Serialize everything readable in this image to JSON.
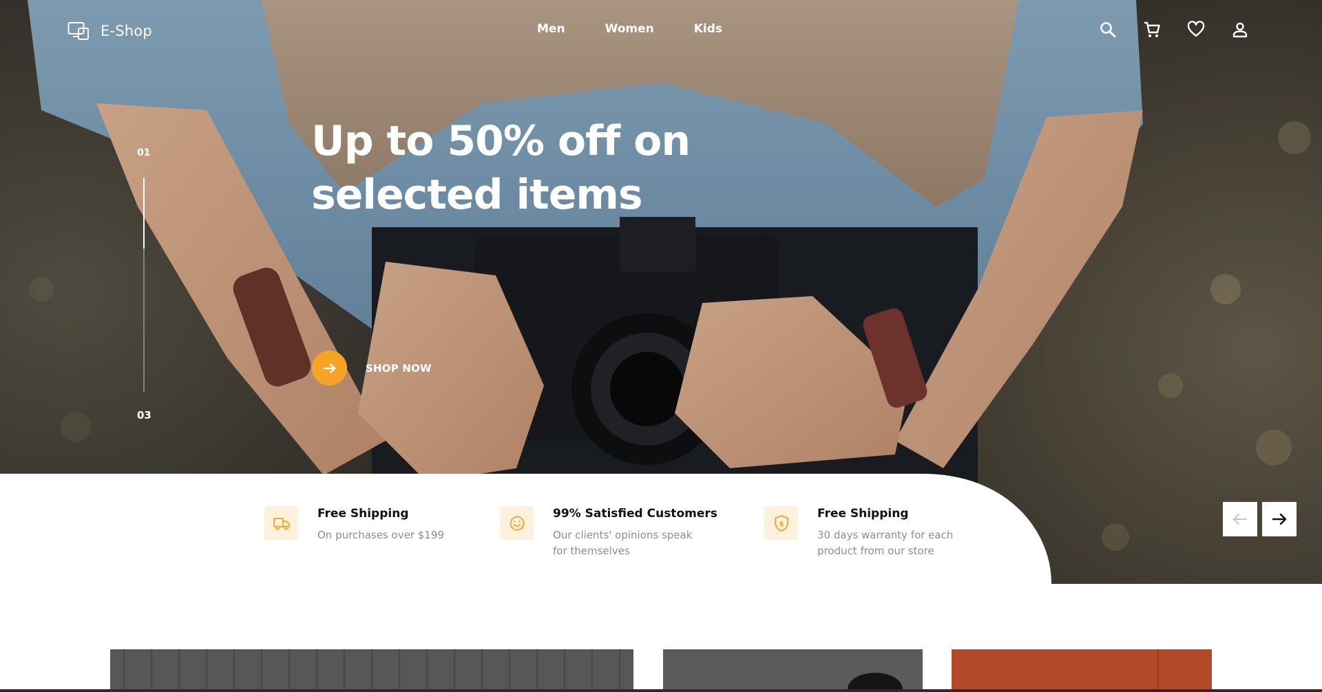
{
  "brand": {
    "name": "E-Shop"
  },
  "nav": {
    "links": [
      "Men",
      "Women",
      "Kids"
    ],
    "icons": [
      "search-icon",
      "cart-icon",
      "heart-icon",
      "user-icon"
    ]
  },
  "hero": {
    "slide_start": "01",
    "slide_end": "03",
    "slide_progress": 0.33,
    "headline_line1": "Up to 50% off on",
    "headline_line2": "selected items",
    "cta_label": "SHOP NOW"
  },
  "features": [
    {
      "icon": "truck-icon",
      "title": "Free Shipping",
      "desc_line1": "On purchases over $199",
      "desc_line2": ""
    },
    {
      "icon": "smile-icon",
      "title": "99% Satisfied Customers",
      "desc_line1": "Our clients' opinions speak",
      "desc_line2": "for themselves"
    },
    {
      "icon": "shield-dollar-icon",
      "title": "Free Shipping",
      "desc_line1": "30 days warranty for each",
      "desc_line2": "product from our store"
    }
  ],
  "colors": {
    "accent": "#f7a325",
    "feature_icon_bg": "#fdf0dc",
    "muted_text": "#8c8c8c"
  }
}
